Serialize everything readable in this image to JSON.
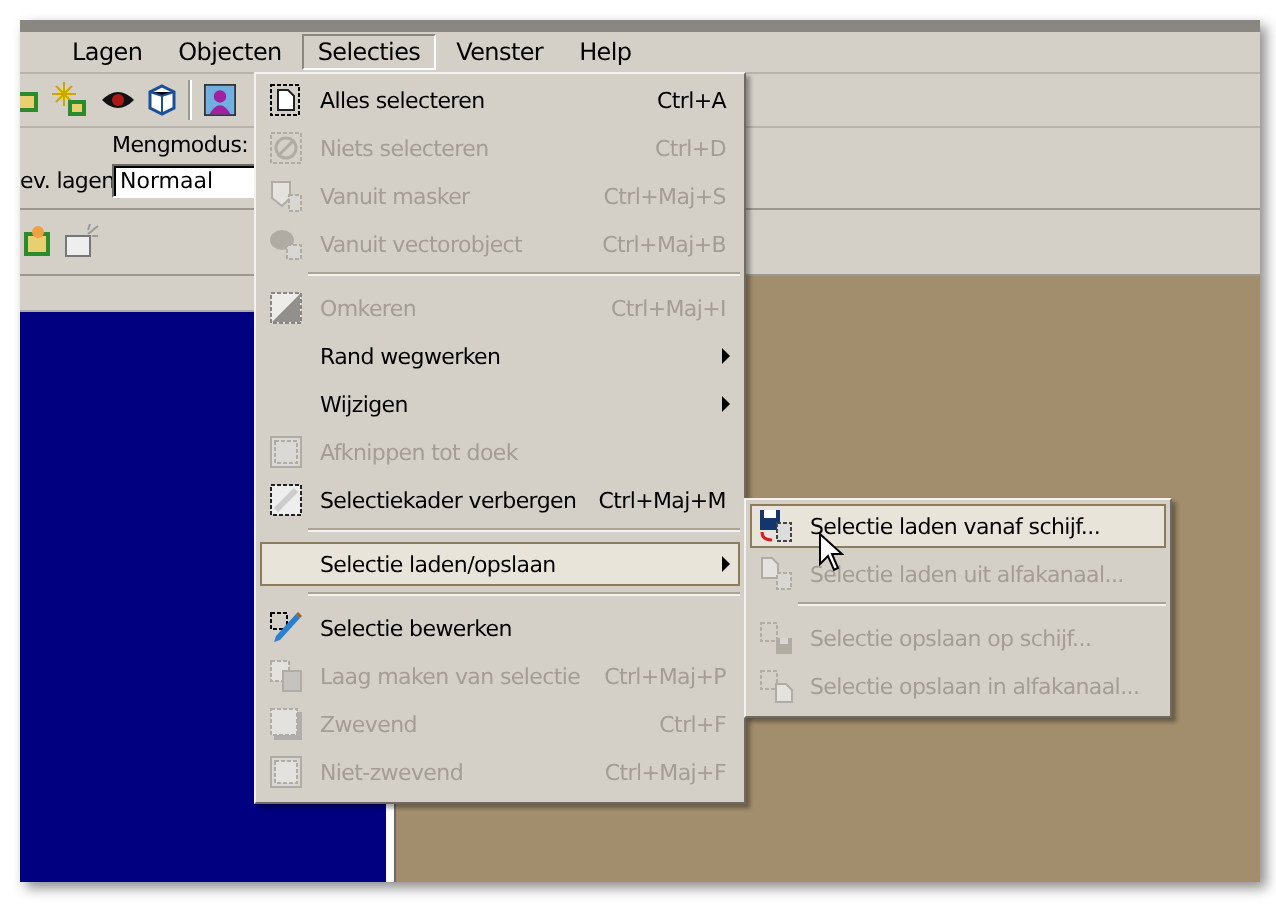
{
  "menubar": [
    {
      "label": "Lagen",
      "selected": false
    },
    {
      "label": "Objecten",
      "selected": false
    },
    {
      "label": "Selecties",
      "selected": true
    },
    {
      "label": "Venster",
      "selected": false
    },
    {
      "label": "Help",
      "selected": false
    }
  ],
  "options": {
    "blend_label": "Mengmodus:",
    "layers_label": "ev. lagen",
    "blend_value": "Normaal"
  },
  "menu": {
    "items": [
      {
        "kind": "item",
        "label": "Alles selecteren",
        "shortcut": "Ctrl+A",
        "disabled": false,
        "has_submenu": false,
        "selected": false
      },
      {
        "kind": "item",
        "label": "Niets selecteren",
        "shortcut": "Ctrl+D",
        "disabled": true,
        "has_submenu": false,
        "selected": false
      },
      {
        "kind": "item",
        "label": "Vanuit masker",
        "shortcut": "Ctrl+Maj+S",
        "disabled": true,
        "has_submenu": false,
        "selected": false
      },
      {
        "kind": "item",
        "label": "Vanuit vectorobject",
        "shortcut": "Ctrl+Maj+B",
        "disabled": true,
        "has_submenu": false,
        "selected": false
      },
      {
        "kind": "separator"
      },
      {
        "kind": "item",
        "label": "Omkeren",
        "shortcut": "Ctrl+Maj+I",
        "disabled": true,
        "has_submenu": false,
        "selected": false
      },
      {
        "kind": "item",
        "label": "Rand wegwerken",
        "disabled": false,
        "has_submenu": true,
        "selected": false
      },
      {
        "kind": "item",
        "label": "Wijzigen",
        "disabled": false,
        "has_submenu": true,
        "selected": false
      },
      {
        "kind": "item",
        "label": "Afknippen tot doek",
        "disabled": true,
        "has_submenu": false,
        "selected": false
      },
      {
        "kind": "item",
        "label": "Selectiekader verbergen",
        "shortcut": "Ctrl+Maj+M",
        "disabled": false,
        "has_submenu": false,
        "selected": false
      },
      {
        "kind": "separator"
      },
      {
        "kind": "item",
        "label": "Selectie laden/opslaan",
        "disabled": false,
        "has_submenu": true,
        "selected": true
      },
      {
        "kind": "separator"
      },
      {
        "kind": "item",
        "label": "Selectie bewerken",
        "disabled": false,
        "has_submenu": false,
        "selected": false
      },
      {
        "kind": "item",
        "label": "Laag maken van selectie",
        "shortcut": "Ctrl+Maj+P",
        "disabled": true,
        "has_submenu": false,
        "selected": false
      },
      {
        "kind": "item",
        "label": "Zwevend",
        "shortcut": "Ctrl+F",
        "disabled": true,
        "has_submenu": false,
        "selected": false
      },
      {
        "kind": "item",
        "label": "Niet-zwevend",
        "shortcut": "Ctrl+Maj+F",
        "disabled": true,
        "has_submenu": false,
        "selected": false
      }
    ]
  },
  "submenu": {
    "items": [
      {
        "kind": "item",
        "label": "Selectie laden vanaf schijf...",
        "disabled": false,
        "has_submenu": false,
        "selected": true
      },
      {
        "kind": "item",
        "label": "Selectie laden uit alfakanaal...",
        "disabled": true,
        "has_submenu": false,
        "selected": false
      },
      {
        "kind": "separator"
      },
      {
        "kind": "item",
        "label": "Selectie opslaan op schijf...",
        "disabled": true,
        "has_submenu": false,
        "selected": false
      },
      {
        "kind": "item",
        "label": "Selectie opslaan in alfakanaal...",
        "disabled": true,
        "has_submenu": false,
        "selected": false
      }
    ]
  }
}
